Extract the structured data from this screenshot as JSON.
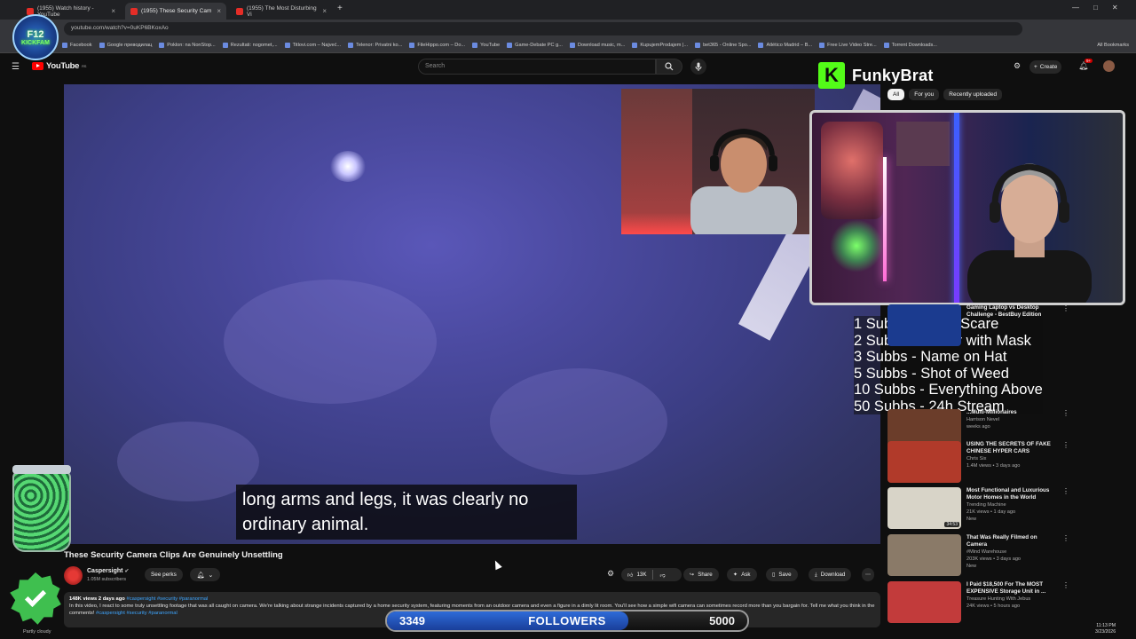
{
  "browser": {
    "tabs": [
      {
        "label": "(1955) Watch history - YouTube",
        "active": false
      },
      {
        "label": "(1955) These Security Cam",
        "active": true
      },
      {
        "label": "(1955) The Most Disturbing Vi",
        "active": false
      }
    ],
    "url": "youtube.com/watch?v=0uKP6BKoxAo",
    "bookmarks": [
      "Facebook",
      "Google преводилац",
      "Poklon: na NonStop...",
      "Rezultati: nogomet,...",
      "Titlovi.com – Najveć...",
      "Telenor: Privatni ko...",
      "FileHippo.com – Do...",
      "YouTube",
      "Game-Debate PC g...",
      "Download music, m...",
      "KupujemProdajem |...",
      "bet365 - Online Spo...",
      "Atlético Madrid – B...",
      "Free Live Video Stre...",
      "Torrent Downloads..."
    ],
    "all_bookmarks": "All Bookmarks"
  },
  "youtube": {
    "logo_text": "YouTube",
    "region": "RS",
    "search_placeholder": "Search",
    "create_label": "Create",
    "notif_count": "9+",
    "chips": [
      "All",
      "For you",
      "Recently uploaded"
    ]
  },
  "video": {
    "caption_line1": "long arms and legs, it was clearly no",
    "caption_line2": "ordinary animal.",
    "title": "These Security Camera Clips Are Genuinely Unsettling",
    "channel": "Caspersight",
    "subscribers": "1.05M subscribers",
    "perks_label": "See perks",
    "likes": "13K",
    "share_label": "Share",
    "ask_label": "Ask",
    "save_label": "Save",
    "download_label": "Download",
    "stats": "148K views  2 days ago",
    "hashtags": "#caspersight #security #paranormal",
    "description": "In this video, I react to some truly unsettling footage that was all caught on camera. We're talking about strange incidents captured by a home security system, featuring moments from an outdoor camera and even a figure in a dimly lit room. You'll see how a simple wifi camera can sometimes record more than you bargain for. Tell me what you think in the comments!",
    "desc_tags": "#caspersight #security #paranormal"
  },
  "stream": {
    "streamer": "FunkyBrat",
    "k_logo": "K",
    "sub_goals": [
      "1 Subbs - Jump Scare",
      "2 Subbs - 1 hour with Mask",
      "3 Subbs - Name on Hat",
      "5 Subbs - Shot of Weed",
      "10 Subbs - Everything Above",
      "50 Subbs - 24h Stream"
    ],
    "followers_current": "3349",
    "followers_label": "FOLLOWERS",
    "followers_goal": "5000",
    "followers_progress": 0.67,
    "f12_line1": "F12",
    "f12_line2": "KICKFAM"
  },
  "recommendations": [
    {
      "title": "Gaming Laptop vs Desktop Challenge - BestBuy Edition",
      "channel": "",
      "views": "",
      "duration": "",
      "color": "#1b3b8f"
    },
    {
      "title": "...Multi-Millionaires",
      "channel": "Harrison Nevel",
      "views": "weeks ago",
      "duration": "",
      "color": "#6b3d2a"
    },
    {
      "title": "USING THE SECRETS OF FAKE CHINESE HYPER CARS",
      "channel": "Chris Six",
      "views": "1.4M views • 3 days ago",
      "duration": "",
      "color": "#b13a2a"
    },
    {
      "title": "Most Functional and Luxurious Motor Homes in the World",
      "channel": "Trending Machine",
      "views": "21K views • 1 day ago",
      "duration": "34:53",
      "badge": "New",
      "color": "#d8d4c8"
    },
    {
      "title": "That Was Really Filmed on Camera",
      "channel": "#Mind Warehouse",
      "views": "203K views • 3 days ago",
      "duration": "",
      "badge": "New",
      "color": "#8a7a68"
    },
    {
      "title": "I Paid $18,500 For The MOST EXPENSIVE Storage Unit in ...",
      "channel": "Treasure Hunting With Jebus",
      "views": "24K views • 5 hours ago",
      "duration": "",
      "color": "#c23b3b"
    }
  ],
  "taskbar": {
    "weather": "Partly cloudy",
    "time": "11:13 PM",
    "date": "3/23/2026"
  }
}
